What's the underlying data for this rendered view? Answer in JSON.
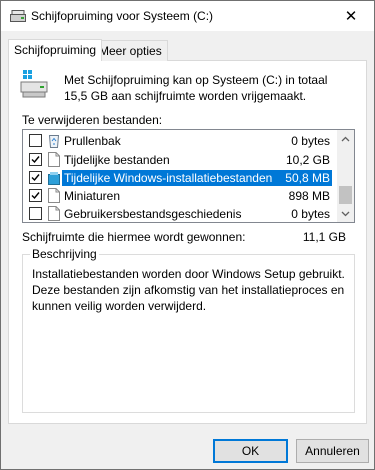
{
  "window": {
    "title": "Schijfopruiming voor Systeem (C:)",
    "close_glyph": "✕"
  },
  "tabs": [
    {
      "label": "Schijfopruiming",
      "active": true
    },
    {
      "label": "Meer opties",
      "active": false
    }
  ],
  "intro": {
    "text": "Met Schijfopruiming kan op Systeem (C:) in totaal 15,5 GB aan schijfruimte worden vrijgemaakt.",
    "icon": "drive-cleanup-icon"
  },
  "files_to_delete": {
    "label": "Te verwijderen bestanden:",
    "items": [
      {
        "name": "Prullenbak",
        "size": "0 bytes",
        "checked": false,
        "icon": "recycle-bin-icon",
        "selected": false
      },
      {
        "name": "Tijdelijke bestanden",
        "size": "10,2 GB",
        "checked": true,
        "icon": "file-icon",
        "selected": false
      },
      {
        "name": "Tijdelijke Windows-installatiebestanden",
        "size": "50,8 MB",
        "checked": true,
        "icon": "windows-setup-icon",
        "selected": true
      },
      {
        "name": "Miniaturen",
        "size": "898 MB",
        "checked": true,
        "icon": "file-icon",
        "selected": false
      },
      {
        "name": "Gebruikersbestandsgeschiedenis",
        "size": "0 bytes",
        "checked": false,
        "icon": "file-icon",
        "selected": false
      }
    ]
  },
  "gain": {
    "label": "Schijfruimte die hiermee wordt gewonnen:",
    "value": "11,1 GB"
  },
  "description": {
    "title": "Beschrijving",
    "text": "Installatiebestanden worden door Windows Setup gebruikt. Deze bestanden zijn afkomstig van het installatieproces en kunnen veilig worden verwijderd."
  },
  "buttons": {
    "ok": "OK",
    "cancel": "Annuleren"
  },
  "colors": {
    "selection": "#0078d7",
    "accent": "#0078d7"
  }
}
